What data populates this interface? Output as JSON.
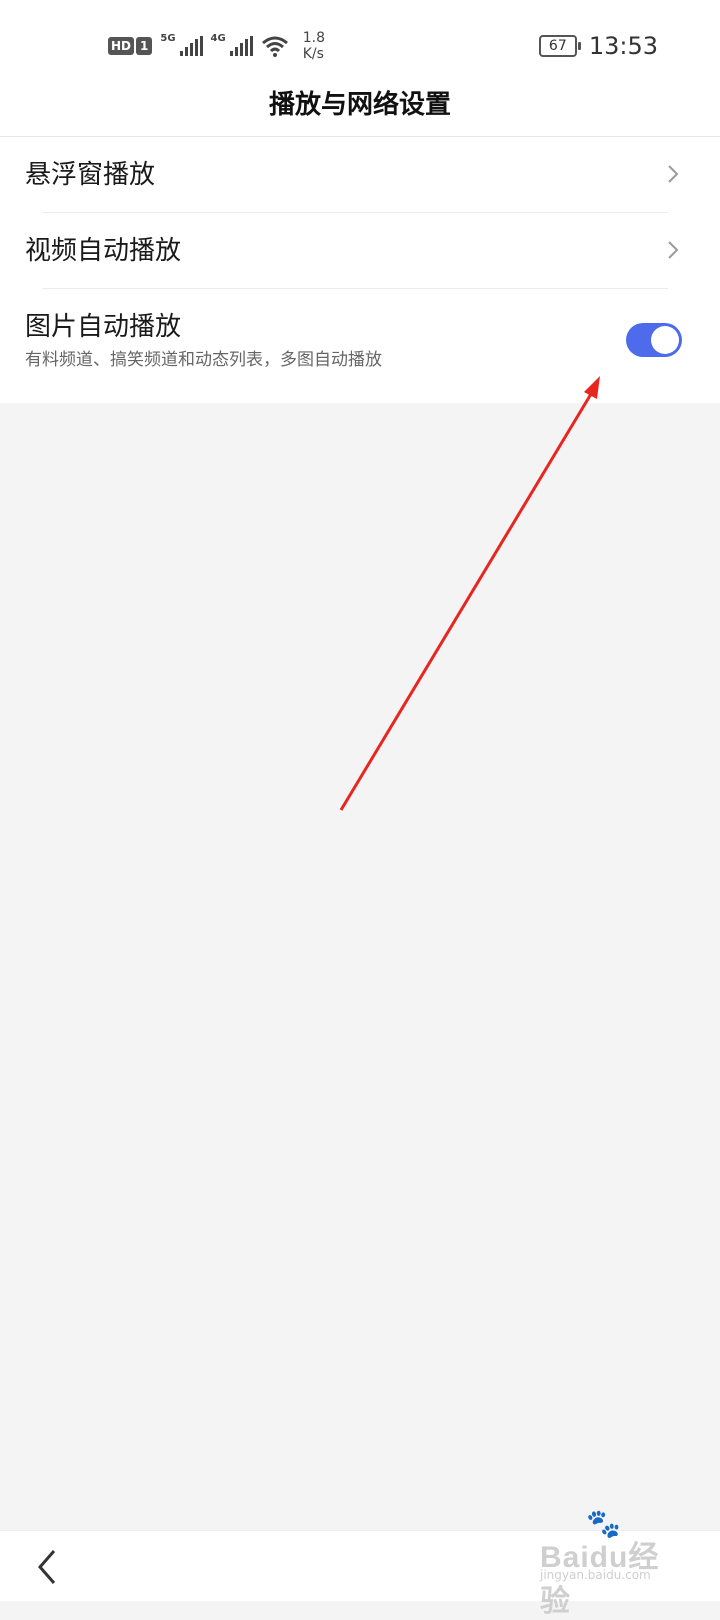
{
  "status_bar": {
    "hd_label": "HD",
    "sim_label": "1",
    "net1": "5G",
    "net2": "4G",
    "speed_value": "1.8",
    "speed_unit": "K/s",
    "battery": "67",
    "time": "13:53"
  },
  "header": {
    "title": "播放与网络设置"
  },
  "settings": [
    {
      "label": "悬浮窗播放"
    },
    {
      "label": "视频自动播放"
    },
    {
      "label": "图片自动播放",
      "subtitle": "有料频道、搞笑频道和动态列表，多图自动播放",
      "toggle_on": true
    }
  ],
  "colors": {
    "accent": "#4d6bea",
    "annotation_arrow": "#e8251f",
    "background": "#f4f4f5"
  },
  "icons": {
    "chevron": "chevron-right-icon",
    "back": "back-arrow-icon",
    "wifi": "wifi-icon"
  },
  "watermark": {
    "brand": "Baidu经验",
    "domain": "jingyan.baidu.com"
  }
}
